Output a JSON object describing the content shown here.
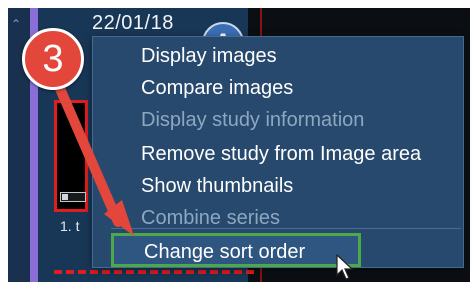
{
  "study": {
    "date": "22/01/18",
    "avatar_letter": "A",
    "series_label": "1. t"
  },
  "callout": {
    "number": "3",
    "color": "#e3473c"
  },
  "context_menu": {
    "items": [
      {
        "label": "Display images",
        "enabled": true
      },
      {
        "label": "Compare images",
        "enabled": true
      },
      {
        "label": "Display study information",
        "enabled": false
      },
      {
        "label": "Remove study from Image area",
        "enabled": true
      },
      {
        "label": "Show thumbnails",
        "enabled": true
      },
      {
        "label": "Combine series",
        "enabled": false
      },
      {
        "label": "Change sort order",
        "enabled": true,
        "highlighted": true
      }
    ]
  },
  "colors": {
    "highlight_border": "#4ca94a",
    "annotation_red": "#e3473c",
    "menu_background": "#27496d"
  }
}
